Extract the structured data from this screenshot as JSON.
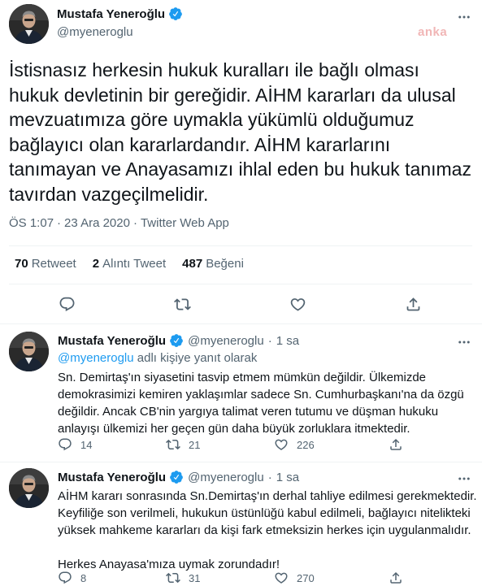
{
  "main_tweet": {
    "author_name": "Mustafa Yeneroğlu",
    "handle": "@myeneroglu",
    "watermark": "anka",
    "text": "İstisnasız herkesin hukuk kuralları ile bağlı olması hukuk devletinin bir gereğidir. AİHM kararları da ulusal mevzuatımıza göre uymakla yükümlü olduğumuz bağlayıcı olan kararlardandır. AİHM kararlarını tanımayan ve Anayasamızı ihlal eden bu hukuk tanımaz tavırdan vazgeçilmelidir.",
    "time": "ÖS 1:07",
    "date": "23 Ara 2020",
    "source": "Twitter Web App",
    "meta_sep": "·",
    "stats": {
      "retweets_count": "70",
      "retweets_label": "Retweet",
      "quotes_count": "2",
      "quotes_label": "Alıntı Tweet",
      "likes_count": "487",
      "likes_label": "Beğeni"
    }
  },
  "replies": [
    {
      "author_name": "Mustafa Yeneroğlu",
      "handle": "@myeneroglu",
      "sep": "·",
      "time": "1 sa",
      "reply_to_handle": "@myeneroglu",
      "reply_to_suffix": " adlı kişiye yanıt olarak",
      "text": "Sn. Demirtaş'ın siyasetini tasvip etmem mümkün değildir. Ülkemizde demokrasimizi kemiren yaklaşımlar sadece Sn. Cumhurbaşkanı'na da özgü değildir. Ancak CB'nin yargıya talimat veren tutumu ve düşman hukuku anlayışı ülkemizi her geçen gün daha büyük zorluklara itmektedir.",
      "reply_count": "14",
      "retweet_count": "21",
      "like_count": "226"
    },
    {
      "author_name": "Mustafa Yeneroğlu",
      "handle": "@myeneroglu",
      "sep": "·",
      "time": "1 sa",
      "text": "AİHM kararı sonrasında Sn.Demirtaş'ın derhal tahliye edilmesi gerekmektedir. Keyfiliğe son verilmeli, hukukun üstünlüğü kabul edilmeli, bağlayıcı nitelikteki yüksek mahkeme kararları da kişi fark etmeksizin herkes için uygulanmalıdır.",
      "text_2": "Herkes Anayasa'mıza uymak zorundadır!",
      "reply_count": "8",
      "retweet_count": "31",
      "like_count": "270"
    }
  ],
  "icons": {
    "verified": "verified-badge-icon",
    "more": "more-horizontal-icon",
    "reply": "reply-bubble-icon",
    "retweet": "retweet-arrows-icon",
    "like": "heart-icon",
    "share": "share-upload-icon"
  },
  "colors": {
    "accent": "#1d9bf0",
    "text": "#0f1419",
    "muted": "#536471",
    "divider": "#eff3f4",
    "watermark": "#f1b6b6"
  }
}
